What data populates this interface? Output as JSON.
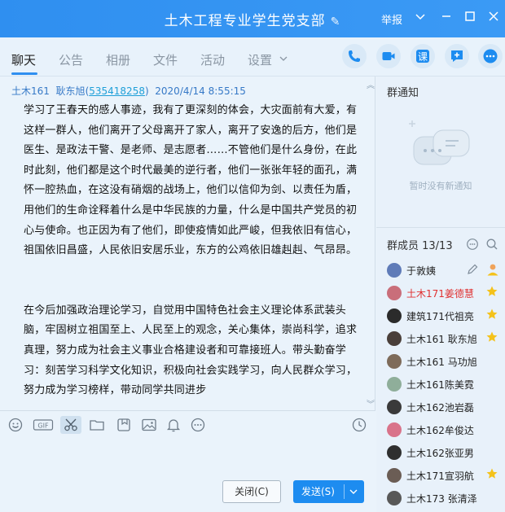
{
  "window": {
    "title": "土木工程专业学生党支部",
    "report_label": "举报",
    "colors": {
      "titlebar": "#2f8ff0",
      "accent": "#1d8cf0",
      "star": "#f4c21b",
      "red_name": "#e03131"
    }
  },
  "tabs": [
    {
      "label": "聊天",
      "active": true
    },
    {
      "label": "公告",
      "active": false
    },
    {
      "label": "相册",
      "active": false
    },
    {
      "label": "文件",
      "active": false
    },
    {
      "label": "活动",
      "active": false
    },
    {
      "label": "设置",
      "active": false
    }
  ],
  "header_actions": [
    {
      "icon": "phone-icon"
    },
    {
      "icon": "video-icon"
    },
    {
      "icon": "lesson-icon",
      "text": "课"
    },
    {
      "icon": "message-plus-icon"
    },
    {
      "icon": "more-icon"
    }
  ],
  "message": {
    "sender_group": "土木161",
    "sender_name": "耿东旭",
    "sender_qq": "535418258",
    "timestamp": "2020/4/14 8:55:15",
    "paragraphs": [
      "学习了王春天的感人事迹，我有了更深刻的体会，大灾面前有大爱，有这样一群人，他们离开了父母离开了家人，离开了安逸的后方，他们是医生、是政法干警、是老师、是志愿者……不管他们是什么身份，在此时此刻，他们都是这个时代最美的逆行者，他们一张张年轻的面孔，满怀一腔热血，在这没有硝烟的战场上，他们以信仰为剑、以责任为盾，用他们的生命诠释着什么是中华民族的力量，什么是中国共产党员的初心与使命。也正因为有了他们，即使疫情如此严峻，但我依旧有信心，祖国依旧昌盛，人民依旧安居乐业，东方的公鸡依旧雄赳赳、气昂昂。",
      "在今后加强政治理论学习，自觉用中国特色社会主义理论体系武装头脑，牢固树立祖国至上、人民至上的观念，关心集体，崇尚科学，追求真理，努力成为社会主义事业合格建设者和可靠接班人。带头勤奋学习：刻苦学习科学文化知识，积极向社会实践学习，向人民群众学习，努力成为学习榜样，带动同学共同进步"
    ]
  },
  "toolbar": {
    "tools": [
      "emoji-icon",
      "gif-icon",
      "scissors-icon",
      "folder-icon",
      "sticker-icon",
      "image-icon",
      "bell-icon",
      "more-circle-icon"
    ],
    "history_icon": "clock-icon"
  },
  "input": {
    "close_label": "关闭(C)",
    "send_label": "发送(S)"
  },
  "notice": {
    "title": "群通知",
    "empty_text": "暂时没有新通知"
  },
  "members": {
    "title": "群成员 13/13",
    "list": [
      {
        "name": "于敦姨",
        "red": false,
        "star": false,
        "avatar": "#5f7bb8"
      },
      {
        "name": "土木171姜德慧",
        "red": true,
        "star": true,
        "avatar": "#c96e7a"
      },
      {
        "name": "建筑171代祖亮",
        "red": false,
        "star": true,
        "avatar": "#2b2b2b"
      },
      {
        "name": "土木161  耿东旭",
        "red": false,
        "star": true,
        "avatar": "#4a3f3a"
      },
      {
        "name": "土木161 马功旭",
        "red": false,
        "star": false,
        "avatar": "#7e6b5a"
      },
      {
        "name": "土木161陈美霓",
        "red": false,
        "star": false,
        "avatar": "#8fae9a"
      },
      {
        "name": "土木162池岩磊",
        "red": false,
        "star": false,
        "avatar": "#3a3a3a"
      },
      {
        "name": "土木162牟俊达",
        "red": false,
        "star": false,
        "avatar": "#d9738a"
      },
      {
        "name": "土木162张亚男",
        "red": false,
        "star": false,
        "avatar": "#2f2f2f"
      },
      {
        "name": "土木171宣羽航",
        "red": false,
        "star": true,
        "avatar": "#6b5d55"
      },
      {
        "name": "土木173 张清泽",
        "red": false,
        "star": false,
        "avatar": "#585858"
      }
    ]
  }
}
